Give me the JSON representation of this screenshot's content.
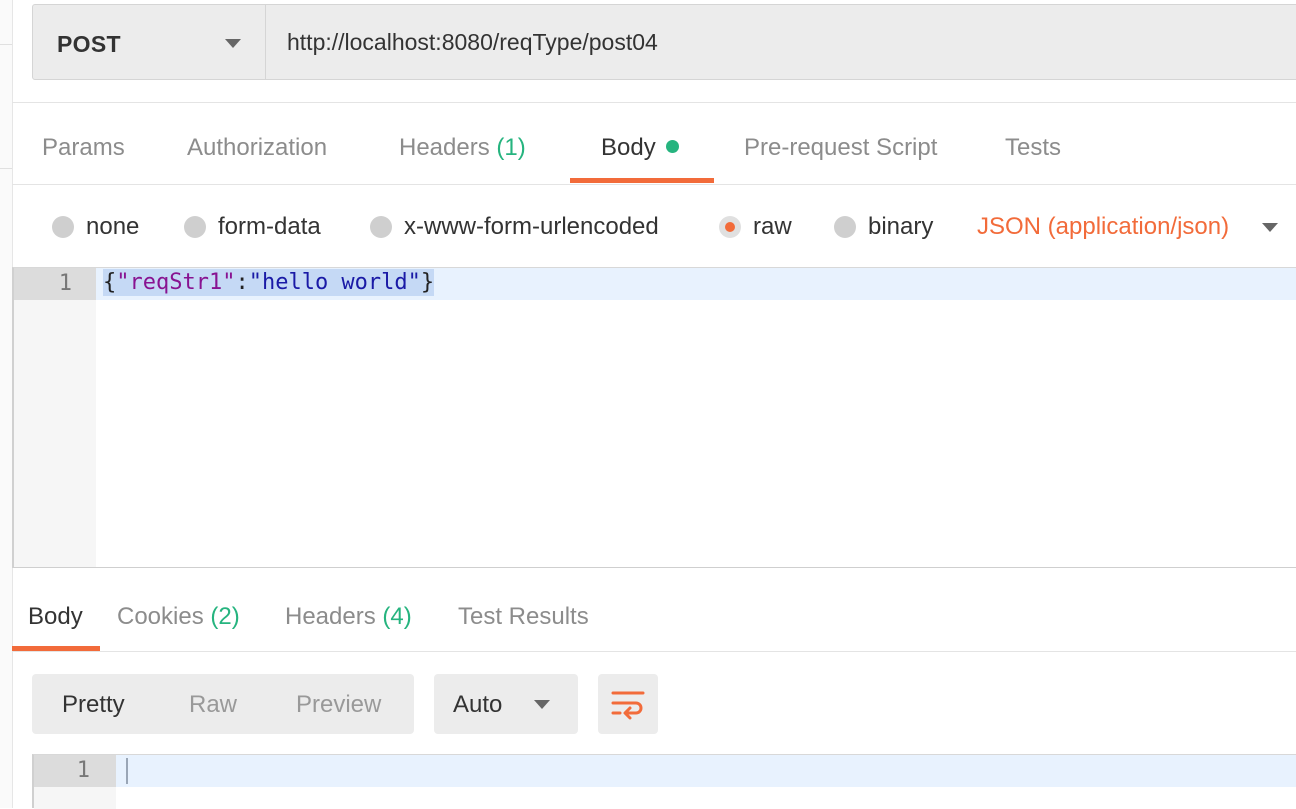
{
  "request": {
    "method": "POST",
    "url": "http://localhost:8080/reqType/post04"
  },
  "request_tabs": {
    "params": "Params",
    "authorization": "Authorization",
    "headers": "Headers",
    "headers_count": "(1)",
    "body": "Body",
    "prerequest": "Pre-request Script",
    "tests": "Tests",
    "active": "Body"
  },
  "body_types": {
    "none": "none",
    "form_data": "form-data",
    "urlencoded": "x-www-form-urlencoded",
    "raw": "raw",
    "binary": "binary",
    "selected": "raw",
    "content_type": "JSON (application/json)"
  },
  "request_editor": {
    "line_number": "1",
    "brace_open": "{",
    "key": "\"reqStr1\"",
    "colon": ":",
    "value": "\"hello world\"",
    "brace_close": "}"
  },
  "response_tabs": {
    "body": "Body",
    "cookies": "Cookies",
    "cookies_count": "(2)",
    "headers": "Headers",
    "headers_count": "(4)",
    "test_results": "Test Results",
    "active": "Body"
  },
  "response_toolbar": {
    "pretty": "Pretty",
    "raw": "Raw",
    "preview": "Preview",
    "format": "Auto",
    "wrap_icon": "wrap-lines-icon"
  },
  "response_editor": {
    "line_number": "1"
  },
  "colors": {
    "accent": "#f26b3a",
    "count": "#26b47f",
    "json_key": "#881391",
    "json_string": "#1a1aa6"
  }
}
